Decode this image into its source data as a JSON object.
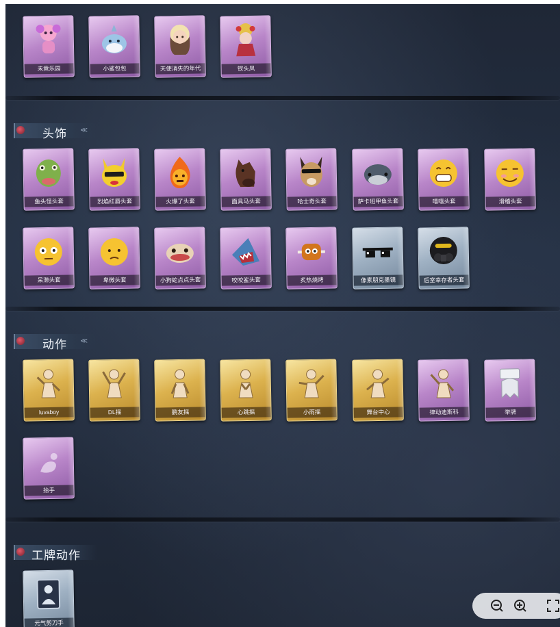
{
  "sections": {
    "headwear": {
      "title": "头饰"
    },
    "actions": {
      "title": "动作"
    },
    "badge_actions": {
      "title": "工牌动作"
    }
  },
  "top_items": [
    {
      "label": "未竟乐园",
      "icon": "pink-doll-icon",
      "color": "purple"
    },
    {
      "label": "小鲨包包",
      "icon": "shark-bag-icon",
      "color": "purple"
    },
    {
      "label": "天使消失的年代",
      "icon": "angel-girl-icon",
      "color": "purple"
    },
    {
      "label": "钗头凤",
      "icon": "phoenix-hairpin-icon",
      "color": "purple"
    }
  ],
  "headwear_items": [
    {
      "label": "鱼头怪头套",
      "icon": "fish-head-icon",
      "color": "purple"
    },
    {
      "label": "烈焰红唇头套",
      "icon": "pikachu-head-icon",
      "color": "purple"
    },
    {
      "label": "火爆了头套",
      "icon": "fireball-head-icon",
      "color": "purple"
    },
    {
      "label": "面具马头套",
      "icon": "horse-head-icon",
      "color": "purple"
    },
    {
      "label": "哈士奇头套",
      "icon": "husky-head-icon",
      "color": "purple"
    },
    {
      "label": "萨卡班甲鱼头套",
      "icon": "sacabambaspis-head-icon",
      "color": "purple"
    },
    {
      "label": "嘻嘻头套",
      "icon": "grin-emoji-icon",
      "color": "purple"
    },
    {
      "label": "滑稽头套",
      "icon": "funny-emoji-icon",
      "color": "purple"
    },
    {
      "label": "呆滞头套",
      "icon": "dazed-emoji-icon",
      "color": "purple"
    },
    {
      "label": "卑微头套",
      "icon": "humble-emoji-icon",
      "color": "purple"
    },
    {
      "label": "小狗蛇点点头套",
      "icon": "snake-head-icon",
      "color": "purple"
    },
    {
      "label": "咬咬鲨头套",
      "icon": "biting-shark-icon",
      "color": "purple"
    },
    {
      "label": "炙热烧烤",
      "icon": "bbq-meat-icon",
      "color": "purple"
    },
    {
      "label": "像素朋克墨镜",
      "icon": "pixel-sunglasses-icon",
      "color": "blue"
    },
    {
      "label": "后室幸存者头套",
      "icon": "gas-mask-helmet-icon",
      "color": "blue"
    }
  ],
  "action_items": [
    {
      "label": "luvaboy",
      "icon": "pose-figure-icon",
      "color": "gold"
    },
    {
      "label": "DL摇",
      "icon": "pose-figure-icon",
      "color": "gold"
    },
    {
      "label": "鹏友摇",
      "icon": "pose-figure-icon",
      "color": "gold"
    },
    {
      "label": "心跳摇",
      "icon": "pose-figure-icon",
      "color": "gold"
    },
    {
      "label": "小雨摇",
      "icon": "pose-figure-icon",
      "color": "gold"
    },
    {
      "label": "舞台中心",
      "icon": "pose-figure-icon",
      "color": "gold"
    },
    {
      "label": "律动迪斯科",
      "icon": "pose-figure-icon",
      "color": "purple"
    },
    {
      "label": "举牌",
      "icon": "ghost-sign-icon",
      "color": "purple"
    },
    {
      "label": "抬手",
      "icon": "raise-hand-icon",
      "color": "purple"
    }
  ],
  "badge_action_items": [
    {
      "label": "元气剪刀手",
      "icon": "badge-card-icon",
      "color": "blue"
    }
  ],
  "zoom_controls": {
    "zoom_out": "zoom-out-icon",
    "zoom_in": "zoom-in-icon",
    "fullscreen": "fullscreen-icon"
  }
}
